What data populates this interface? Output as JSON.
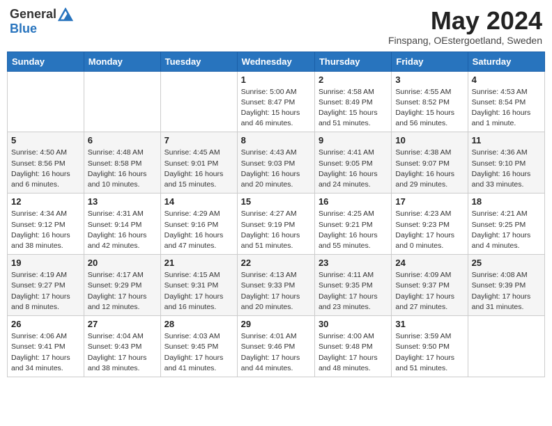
{
  "header": {
    "logo_general": "General",
    "logo_blue": "Blue",
    "month_year": "May 2024",
    "location": "Finspang, OEstergoetland, Sweden"
  },
  "days_of_week": [
    "Sunday",
    "Monday",
    "Tuesday",
    "Wednesday",
    "Thursday",
    "Friday",
    "Saturday"
  ],
  "weeks": [
    [
      {
        "day": "",
        "info": ""
      },
      {
        "day": "",
        "info": ""
      },
      {
        "day": "",
        "info": ""
      },
      {
        "day": "1",
        "info": "Sunrise: 5:00 AM\nSunset: 8:47 PM\nDaylight: 15 hours\nand 46 minutes."
      },
      {
        "day": "2",
        "info": "Sunrise: 4:58 AM\nSunset: 8:49 PM\nDaylight: 15 hours\nand 51 minutes."
      },
      {
        "day": "3",
        "info": "Sunrise: 4:55 AM\nSunset: 8:52 PM\nDaylight: 15 hours\nand 56 minutes."
      },
      {
        "day": "4",
        "info": "Sunrise: 4:53 AM\nSunset: 8:54 PM\nDaylight: 16 hours\nand 1 minute."
      }
    ],
    [
      {
        "day": "5",
        "info": "Sunrise: 4:50 AM\nSunset: 8:56 PM\nDaylight: 16 hours\nand 6 minutes."
      },
      {
        "day": "6",
        "info": "Sunrise: 4:48 AM\nSunset: 8:58 PM\nDaylight: 16 hours\nand 10 minutes."
      },
      {
        "day": "7",
        "info": "Sunrise: 4:45 AM\nSunset: 9:01 PM\nDaylight: 16 hours\nand 15 minutes."
      },
      {
        "day": "8",
        "info": "Sunrise: 4:43 AM\nSunset: 9:03 PM\nDaylight: 16 hours\nand 20 minutes."
      },
      {
        "day": "9",
        "info": "Sunrise: 4:41 AM\nSunset: 9:05 PM\nDaylight: 16 hours\nand 24 minutes."
      },
      {
        "day": "10",
        "info": "Sunrise: 4:38 AM\nSunset: 9:07 PM\nDaylight: 16 hours\nand 29 minutes."
      },
      {
        "day": "11",
        "info": "Sunrise: 4:36 AM\nSunset: 9:10 PM\nDaylight: 16 hours\nand 33 minutes."
      }
    ],
    [
      {
        "day": "12",
        "info": "Sunrise: 4:34 AM\nSunset: 9:12 PM\nDaylight: 16 hours\nand 38 minutes."
      },
      {
        "day": "13",
        "info": "Sunrise: 4:31 AM\nSunset: 9:14 PM\nDaylight: 16 hours\nand 42 minutes."
      },
      {
        "day": "14",
        "info": "Sunrise: 4:29 AM\nSunset: 9:16 PM\nDaylight: 16 hours\nand 47 minutes."
      },
      {
        "day": "15",
        "info": "Sunrise: 4:27 AM\nSunset: 9:19 PM\nDaylight: 16 hours\nand 51 minutes."
      },
      {
        "day": "16",
        "info": "Sunrise: 4:25 AM\nSunset: 9:21 PM\nDaylight: 16 hours\nand 55 minutes."
      },
      {
        "day": "17",
        "info": "Sunrise: 4:23 AM\nSunset: 9:23 PM\nDaylight: 17 hours\nand 0 minutes."
      },
      {
        "day": "18",
        "info": "Sunrise: 4:21 AM\nSunset: 9:25 PM\nDaylight: 17 hours\nand 4 minutes."
      }
    ],
    [
      {
        "day": "19",
        "info": "Sunrise: 4:19 AM\nSunset: 9:27 PM\nDaylight: 17 hours\nand 8 minutes."
      },
      {
        "day": "20",
        "info": "Sunrise: 4:17 AM\nSunset: 9:29 PM\nDaylight: 17 hours\nand 12 minutes."
      },
      {
        "day": "21",
        "info": "Sunrise: 4:15 AM\nSunset: 9:31 PM\nDaylight: 17 hours\nand 16 minutes."
      },
      {
        "day": "22",
        "info": "Sunrise: 4:13 AM\nSunset: 9:33 PM\nDaylight: 17 hours\nand 20 minutes."
      },
      {
        "day": "23",
        "info": "Sunrise: 4:11 AM\nSunset: 9:35 PM\nDaylight: 17 hours\nand 23 minutes."
      },
      {
        "day": "24",
        "info": "Sunrise: 4:09 AM\nSunset: 9:37 PM\nDaylight: 17 hours\nand 27 minutes."
      },
      {
        "day": "25",
        "info": "Sunrise: 4:08 AM\nSunset: 9:39 PM\nDaylight: 17 hours\nand 31 minutes."
      }
    ],
    [
      {
        "day": "26",
        "info": "Sunrise: 4:06 AM\nSunset: 9:41 PM\nDaylight: 17 hours\nand 34 minutes."
      },
      {
        "day": "27",
        "info": "Sunrise: 4:04 AM\nSunset: 9:43 PM\nDaylight: 17 hours\nand 38 minutes."
      },
      {
        "day": "28",
        "info": "Sunrise: 4:03 AM\nSunset: 9:45 PM\nDaylight: 17 hours\nand 41 minutes."
      },
      {
        "day": "29",
        "info": "Sunrise: 4:01 AM\nSunset: 9:46 PM\nDaylight: 17 hours\nand 44 minutes."
      },
      {
        "day": "30",
        "info": "Sunrise: 4:00 AM\nSunset: 9:48 PM\nDaylight: 17 hours\nand 48 minutes."
      },
      {
        "day": "31",
        "info": "Sunrise: 3:59 AM\nSunset: 9:50 PM\nDaylight: 17 hours\nand 51 minutes."
      },
      {
        "day": "",
        "info": ""
      }
    ]
  ]
}
